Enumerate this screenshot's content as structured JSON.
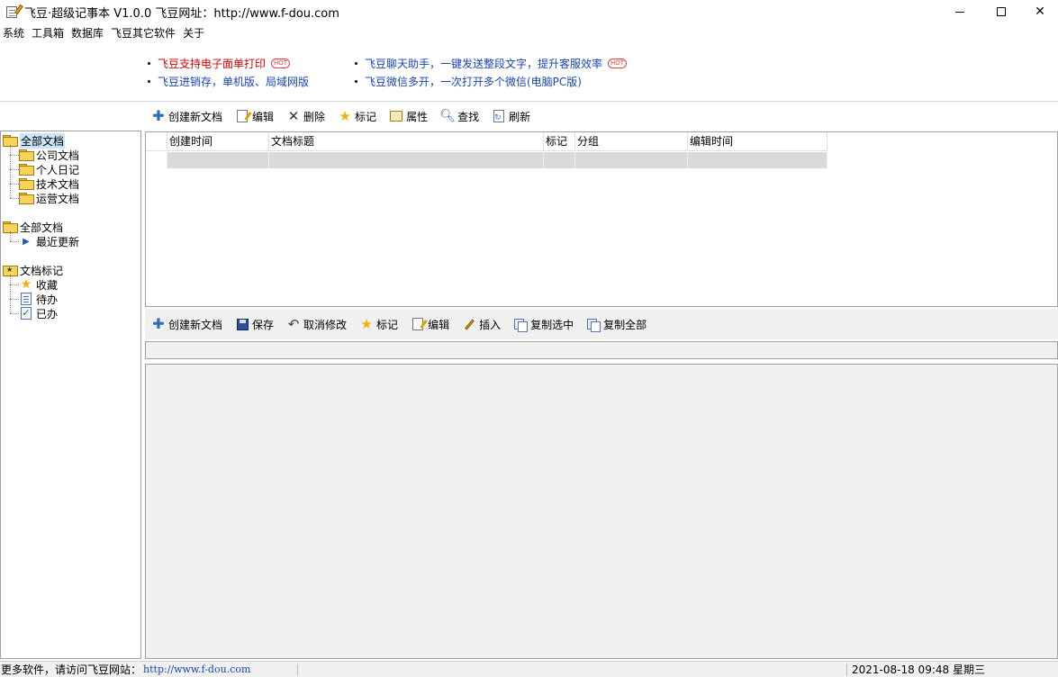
{
  "window": {
    "title": "飞豆·超级记事本 V1.0.0  飞豆网址：http://www.f-dou.com"
  },
  "menu": [
    "系统",
    "工具箱",
    "数据库",
    "飞豆其它软件",
    "关于"
  ],
  "promo": {
    "left": [
      {
        "text": "飞豆支持电子面单打印",
        "hot": true,
        "color": "#d40000"
      },
      {
        "text": "飞豆进销存，单机版、局域网版",
        "hot": false,
        "color": "#1a44b0"
      }
    ],
    "right": [
      {
        "text": "飞豆聊天助手，一键发送整段文字，提升客服效率",
        "hot": true,
        "color": "#1a44b0"
      },
      {
        "text": "飞豆微信多开，一次打开多个微信(电脑PC版)",
        "hot": false,
        "color": "#1a44b0"
      }
    ],
    "hot_label": "HOT"
  },
  "top_toolbar": {
    "create": "创建新文档",
    "edit": "编辑",
    "delete": "删除",
    "mark": "标记",
    "properties": "属性",
    "find": "查找",
    "refresh": "刷新"
  },
  "tree": {
    "group1": {
      "root": "全部文档",
      "children": [
        "公司文档",
        "个人日记",
        "技术文档",
        "运营文档"
      ]
    },
    "group2": {
      "root": "全部文档",
      "children": [
        "最近更新"
      ]
    },
    "group3": {
      "root": "文档标记",
      "children": [
        "收藏",
        "待办",
        "已办"
      ]
    }
  },
  "grid": {
    "columns": [
      "创建时间",
      "文档标题",
      "标记",
      "分组",
      "编辑时间"
    ]
  },
  "editor_toolbar": {
    "create": "创建新文档",
    "save": "保存",
    "undo": "取消修改",
    "mark": "标记",
    "edit": "编辑",
    "insert": "插入",
    "copy_selected": "复制选中",
    "copy_all": "复制全部"
  },
  "status": {
    "more_software": "更多软件，请访问飞豆网站：",
    "website": "http://www.f-dou.com",
    "datetime": "2021-08-18 09:48 星期三"
  }
}
